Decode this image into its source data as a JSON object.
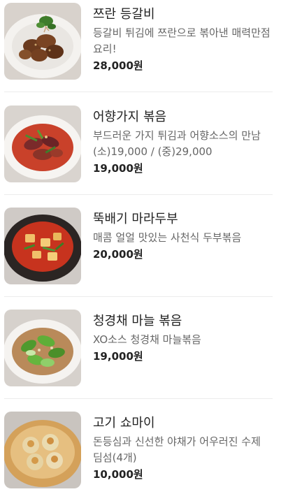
{
  "menu": {
    "items": [
      {
        "name": "쯔란 등갈비",
        "description": "등갈비 튀김에 쯔란으로 볶아낸 매력만점 요리!",
        "price": "28,000원",
        "image_icon": "fried-ribs-dish-photo"
      },
      {
        "name": "어향가지 볶음",
        "description": "부드러운 가지 튀김과 어향소스의 만남 (소)19,000 / (중)29,000",
        "price": "19,000원",
        "image_icon": "eggplant-stirfry-photo"
      },
      {
        "name": "뚝배기 마라두부",
        "description": "매콤 얼얼 맛있는 사천식 두부볶음",
        "price": "20,000원",
        "image_icon": "mala-tofu-pot-photo"
      },
      {
        "name": "청경채 마늘 볶음",
        "description": "XO소스 청경채 마늘볶음",
        "price": "19,000원",
        "image_icon": "bokchoy-garlic-photo"
      },
      {
        "name": "고기 쇼마이",
        "description": "돈등심과 신선한 야채가 어우러진 수제 딤섬(4개)",
        "price": "10,000원",
        "image_icon": "shumai-steamer-photo"
      }
    ]
  }
}
